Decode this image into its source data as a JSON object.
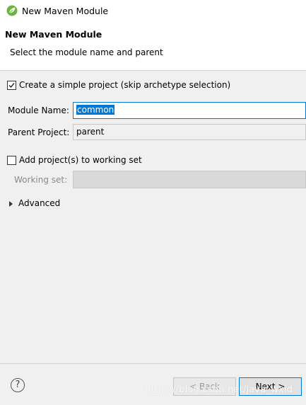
{
  "window": {
    "title": "New Maven Module"
  },
  "banner": {
    "title": "New Maven Module",
    "message": "Select the module name and parent"
  },
  "options": {
    "simple_project_label": "Create a simple project (skip archetype selection)",
    "simple_project_checked": true
  },
  "module_name": {
    "label": "Module Name:",
    "value": "common"
  },
  "parent_project": {
    "label": "Parent Project:",
    "value": "parent"
  },
  "working_set": {
    "add_label": "Add project(s) to working set",
    "add_checked": false,
    "label": "Working set:",
    "value": ""
  },
  "advanced": {
    "label": "Advanced"
  },
  "footer": {
    "back_label": "< Back",
    "next_label": "Next >",
    "help_symbol": "?"
  },
  "watermark": {
    "text": "https://blog.csdn.net/java_wxid"
  },
  "colors": {
    "selection": "#0078d7",
    "background": "#f0f0f0",
    "banner": "#ffffff"
  }
}
